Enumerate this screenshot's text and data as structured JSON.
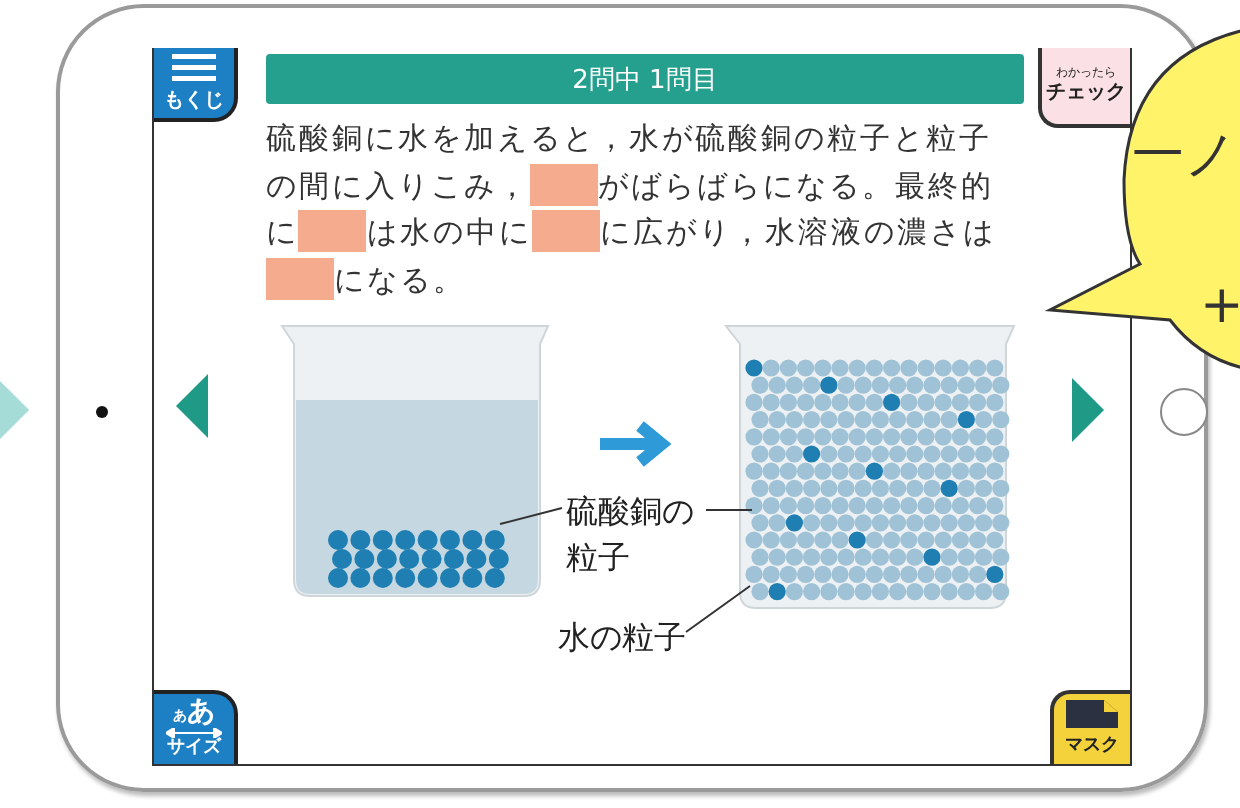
{
  "menu_button": {
    "label": "もくじ"
  },
  "title": "2問中 1問目",
  "check_button": {
    "caption": "わかったら",
    "label": "チェック"
  },
  "question": [
    {
      "kind": "text",
      "text": "硫酸銅に水を加えると，水が硫酸銅の粒子と粒子の間に入りこみ，"
    },
    {
      "kind": "blank"
    },
    {
      "kind": "text",
      "text": "がばらばらになる。最終的に"
    },
    {
      "kind": "blank"
    },
    {
      "kind": "text",
      "text": "は水の中に"
    },
    {
      "kind": "blank"
    },
    {
      "kind": "text",
      "text": "に広がり，水溶液の濃さは"
    },
    {
      "kind": "blank"
    },
    {
      "kind": "text",
      "text": "になる。"
    }
  ],
  "diagram": {
    "labels": [
      {
        "lines": [
          "硫酸銅の",
          "粒子"
        ]
      },
      {
        "lines": [
          "水の粒子"
        ]
      }
    ]
  },
  "size_button": {
    "glyph_small": "あ",
    "glyph": "あ",
    "label": "サイズ"
  },
  "mask_button": {
    "label": "マスク"
  },
  "speech_bubble": {
    "lines": [
      "一ノ",
      "+"
    ]
  }
}
